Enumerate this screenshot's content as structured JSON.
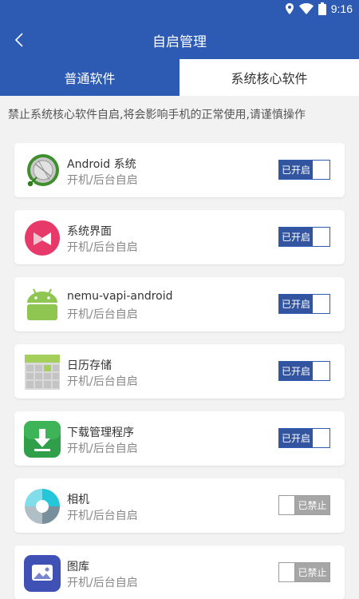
{
  "status_bar": {
    "time": "9:16",
    "icons": [
      "location-icon",
      "wifi-icon",
      "battery-icon"
    ]
  },
  "header": {
    "title": "自启管理",
    "back_icon": "chevron-left-icon"
  },
  "tabs": [
    {
      "label": "普通软件",
      "active": false
    },
    {
      "label": "系统核心软件",
      "active": true
    }
  ],
  "notice": "禁止系统核心软件自启,将会影响手机的正常使用,请谨慎操作",
  "apps": [
    {
      "name": "Android 系统",
      "subtitle": "开机/后台自启",
      "toggle": "已开启",
      "enabled": true,
      "icon": "android-system-icon"
    },
    {
      "name": "系统界面",
      "subtitle": "开机/后台自启",
      "toggle": "已开启",
      "enabled": true,
      "icon": "system-ui-icon"
    },
    {
      "name": "nemu-vapi-android",
      "subtitle": "开机/后台自启",
      "toggle": "已开启",
      "enabled": true,
      "icon": "android-robot-icon"
    },
    {
      "name": "日历存储",
      "subtitle": "开机/后台自启",
      "toggle": "已开启",
      "enabled": true,
      "icon": "calendar-storage-icon"
    },
    {
      "name": "下载管理程序",
      "subtitle": "开机/后台自启",
      "toggle": "已开启",
      "enabled": true,
      "icon": "download-manager-icon"
    },
    {
      "name": "相机",
      "subtitle": "开机/后台自启",
      "toggle": "已禁止",
      "enabled": false,
      "icon": "camera-icon"
    },
    {
      "name": "图库",
      "subtitle": "开机/后台自启",
      "toggle": "已禁止",
      "enabled": false,
      "icon": "gallery-icon"
    }
  ],
  "colors": {
    "primary": "#2d5bb3",
    "toggle_on": "#3355a0",
    "toggle_off": "#a6a6a6",
    "background": "#f2f2f2"
  }
}
